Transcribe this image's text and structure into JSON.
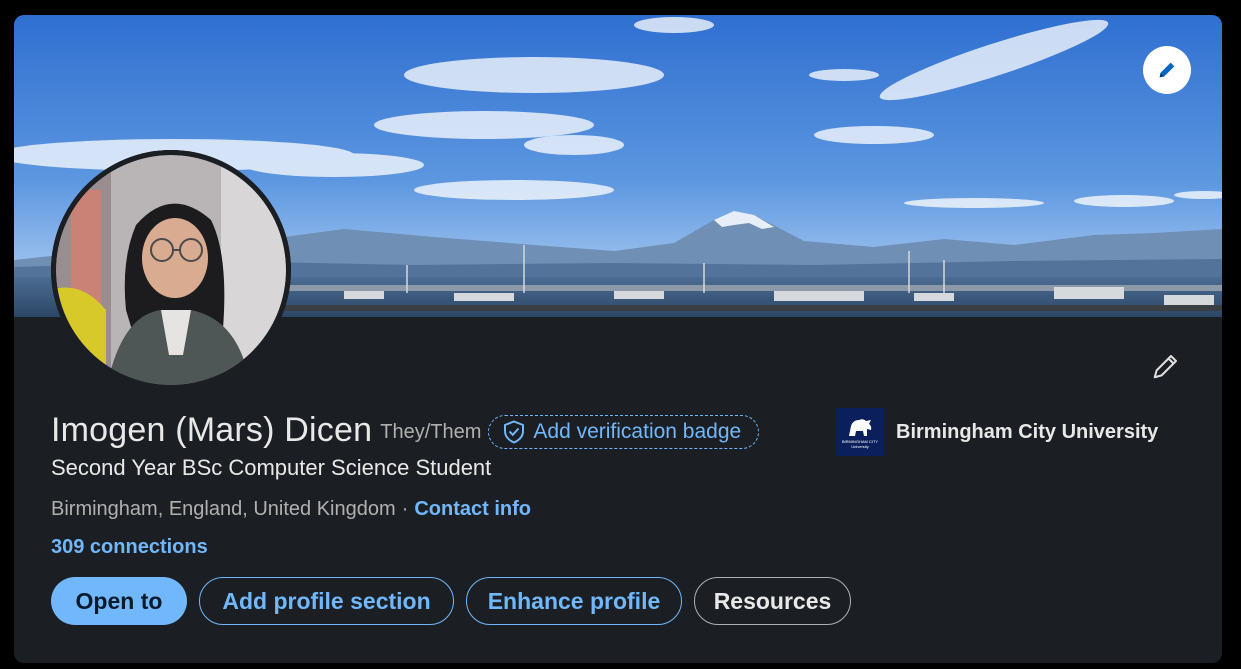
{
  "profile": {
    "name": "Imogen (Mars) Dicen",
    "pronouns": "They/Them",
    "verification_label": "Add verification badge",
    "headline": "Second Year BSc Computer Science Student",
    "location": "Birmingham, England, United Kingdom",
    "separator": "·",
    "contact_label": "Contact info",
    "connections": "309 connections"
  },
  "education": {
    "school_name": "Birmingham City University",
    "logo_text_line1": "BIRMINGHAM CITY",
    "logo_text_line2": "University"
  },
  "actions": {
    "open_to": "Open to",
    "add_section": "Add profile section",
    "enhance": "Enhance profile",
    "resources": "Resources"
  },
  "icons": {
    "banner_edit": "pencil-icon",
    "profile_edit": "pencil-icon",
    "verification": "shield-check-icon"
  },
  "colors": {
    "accent": "#71b7fb",
    "card_background": "#1b1f23",
    "page_background": "#000000",
    "text_primary": "#e8e8e8",
    "text_secondary": "#b0b0b0"
  }
}
